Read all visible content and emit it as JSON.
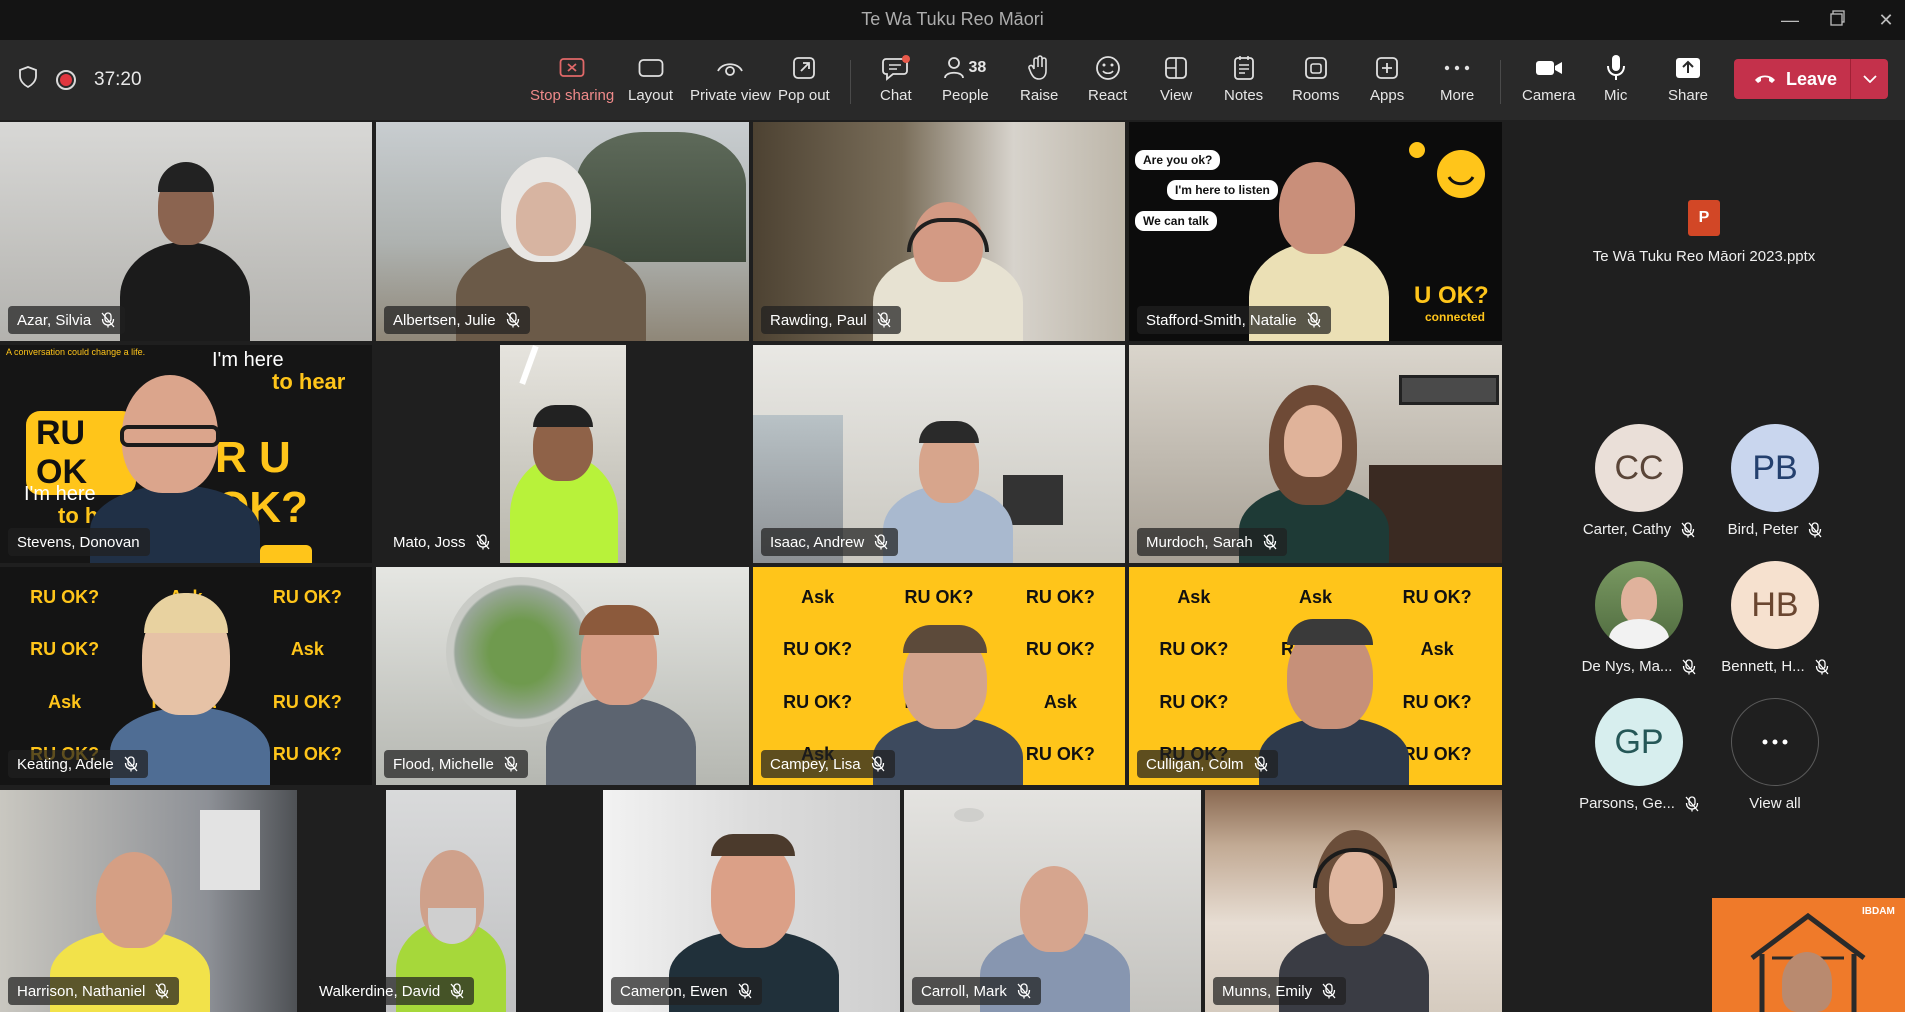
{
  "window": {
    "title": "Te Wa Tuku Reo Māori"
  },
  "toolbar": {
    "timer": "37:20",
    "stop_sharing": "Stop sharing",
    "layout": "Layout",
    "private_view": "Private view",
    "pop_out": "Pop out",
    "chat": "Chat",
    "people": "People",
    "people_count": "38",
    "raise": "Raise",
    "react": "React",
    "view": "View",
    "notes": "Notes",
    "rooms": "Rooms",
    "apps": "Apps",
    "more": "More",
    "camera": "Camera",
    "mic": "Mic",
    "share": "Share",
    "leave": "Leave"
  },
  "participants": [
    {
      "name": "Azar, Silvia"
    },
    {
      "name": "Albertsen, Julie"
    },
    {
      "name": "Rawding, Paul"
    },
    {
      "name": "Stafford-Smith, Natalie"
    },
    {
      "name": "Stevens, Donovan"
    },
    {
      "name": "Mato, Joss"
    },
    {
      "name": "Isaac, Andrew"
    },
    {
      "name": "Murdoch, Sarah"
    },
    {
      "name": "Keating, Adele"
    },
    {
      "name": "Flood, Michelle"
    },
    {
      "name": "Campey, Lisa"
    },
    {
      "name": "Culligan, Colm"
    },
    {
      "name": "Harrison, Nathaniel"
    },
    {
      "name": "Walkerdine, David"
    },
    {
      "name": "Cameron, Ewen"
    },
    {
      "name": "Carroll, Mark"
    },
    {
      "name": "Munns, Emily"
    }
  ],
  "backgrounds": {
    "natalie": {
      "b1": "Are you ok?",
      "b2": "I'm here to listen",
      "b3": "We can talk",
      "brand": "U OK?",
      "brand_sub": "connected"
    },
    "donovan": {
      "tag1": "A conversation could change a life.",
      "h1": "I'm here",
      "h1b": "to hear",
      "logo": "RU OK",
      "logo2": "R U OK?",
      "h2": "I'm here",
      "h2b": "to he"
    },
    "ruok_word": "RU OK?",
    "ask_word": "Ask"
  },
  "shared_content": {
    "filename": "Te Wā Tuku Reo Māori 2023.pptx",
    "app_letter": "P"
  },
  "side_people": [
    {
      "initials": "CC",
      "name": "Carter, Cathy",
      "bg": "#eadfd8",
      "fg": "#5a4538"
    },
    {
      "initials": "PB",
      "name": "Bird, Peter",
      "bg": "#c9d6ee",
      "fg": "#24406e"
    },
    {
      "initials": "",
      "name": "De Nys, Ma...",
      "bg": "#6b8a5a",
      "fg": "#ffffff"
    },
    {
      "initials": "HB",
      "name": "Bennett, H...",
      "bg": "#f6e1cf",
      "fg": "#6a4630"
    },
    {
      "initials": "GP",
      "name": "Parsons, Ge...",
      "bg": "#d7eeee",
      "fg": "#255757"
    },
    {
      "initials": "",
      "name": "View all",
      "bg": "#1f1f1f",
      "fg": "#ffffff"
    }
  ],
  "selfview": {
    "brand": "IBDAM"
  },
  "colors": {
    "leave": "#c4314b",
    "stop": "#e06868",
    "ruok_yellow": "#ffc51a"
  }
}
